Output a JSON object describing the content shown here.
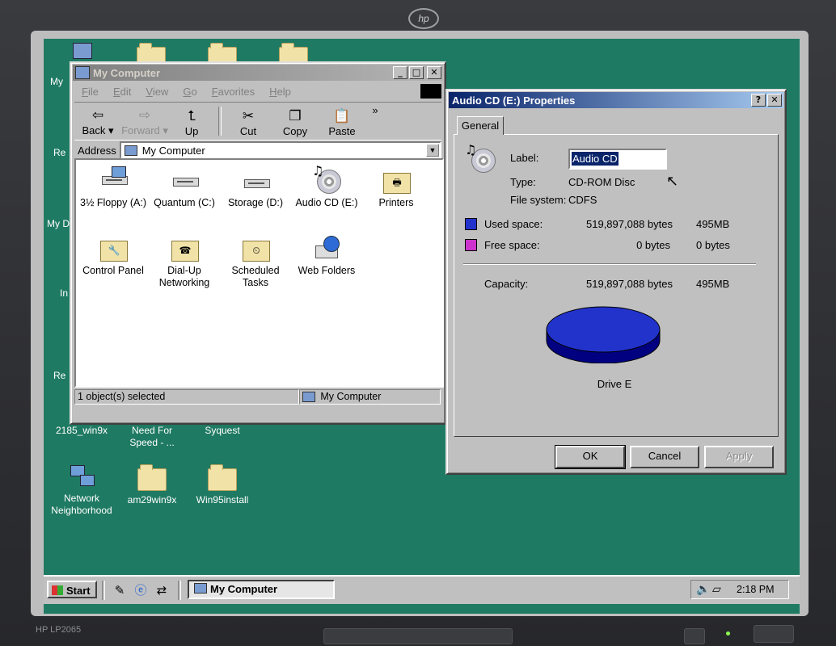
{
  "monitor": {
    "brand_logo": "hp",
    "model": "HP LP2065"
  },
  "desktop": {
    "partial_labels": [
      "My",
      "Re",
      "My D",
      "In",
      "Re"
    ],
    "icons": [
      {
        "label": "2185_win9x"
      },
      {
        "label": "Need For Speed - ..."
      },
      {
        "label": "Syquest"
      },
      {
        "label": "Network Neighborhood"
      },
      {
        "label": "am29win9x"
      },
      {
        "label": "Win95install"
      }
    ]
  },
  "explorer": {
    "title": "My Computer",
    "menu": [
      "File",
      "Edit",
      "View",
      "Go",
      "Favorites",
      "Help"
    ],
    "toolbar": {
      "back": "Back",
      "forward": "Forward",
      "up": "Up",
      "cut": "Cut",
      "copy": "Copy",
      "paste": "Paste",
      "more": "»"
    },
    "address_label": "Address",
    "address_value": "My Computer",
    "items": [
      {
        "label": "3½ Floppy (A:)"
      },
      {
        "label": "Quantum (C:)"
      },
      {
        "label": "Storage (D:)"
      },
      {
        "label": "Audio CD (E:)"
      },
      {
        "label": "Printers"
      },
      {
        "label": "Control Panel"
      },
      {
        "label": "Dial-Up Networking"
      },
      {
        "label": "Scheduled Tasks"
      },
      {
        "label": "Web Folders"
      }
    ],
    "status_left": "1 object(s) selected",
    "status_right": "My Computer"
  },
  "properties": {
    "title": "Audio CD (E:) Properties",
    "help_btn": "?",
    "close_btn": "✕",
    "tab": "General",
    "label_caption": "Label:",
    "label_value": "Audio CD",
    "type_caption": "Type:",
    "type_value": "CD-ROM Disc",
    "fs_caption": "File system:",
    "fs_value": "CDFS",
    "used_caption": "Used space:",
    "used_bytes": "519,897,088 bytes",
    "used_short": "495MB",
    "free_caption": "Free space:",
    "free_bytes": "0 bytes",
    "free_short": "0 bytes",
    "capacity_caption": "Capacity:",
    "capacity_bytes": "519,897,088 bytes",
    "capacity_short": "495MB",
    "drive_caption": "Drive E",
    "used_color": "#2233cc",
    "free_color": "#cc33cc",
    "ok": "OK",
    "cancel": "Cancel",
    "apply": "Apply"
  },
  "taskbar": {
    "start": "Start",
    "task_item": "My Computer",
    "clock": "2:18 PM"
  }
}
